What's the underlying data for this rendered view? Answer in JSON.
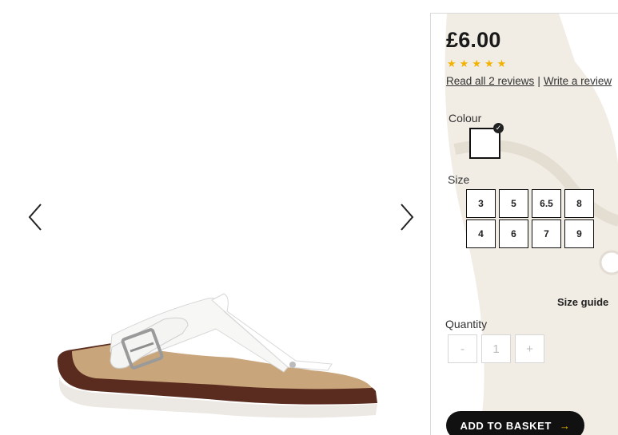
{
  "product": {
    "price": "£6.00",
    "rating_stars": 5,
    "reviews_link": "Read all 2 reviews",
    "reviews_separator": "|",
    "write_review_link": "Write a review"
  },
  "colour": {
    "label": "Colour",
    "selected": "white"
  },
  "size": {
    "label": "Size",
    "options": [
      "3",
      "5",
      "6.5",
      "8",
      "4",
      "6",
      "7",
      "9"
    ],
    "guide_link": "Size guide"
  },
  "quantity": {
    "label": "Quantity",
    "minus": "-",
    "value": "1",
    "plus": "+"
  },
  "basket": {
    "label": "ADD TO BASKET",
    "arrow": "→"
  },
  "gallery": {
    "prev_icon": "chevron-left-icon",
    "next_icon": "chevron-right-icon"
  },
  "colors": {
    "star": "#f2b300",
    "button_bg": "#111111"
  }
}
